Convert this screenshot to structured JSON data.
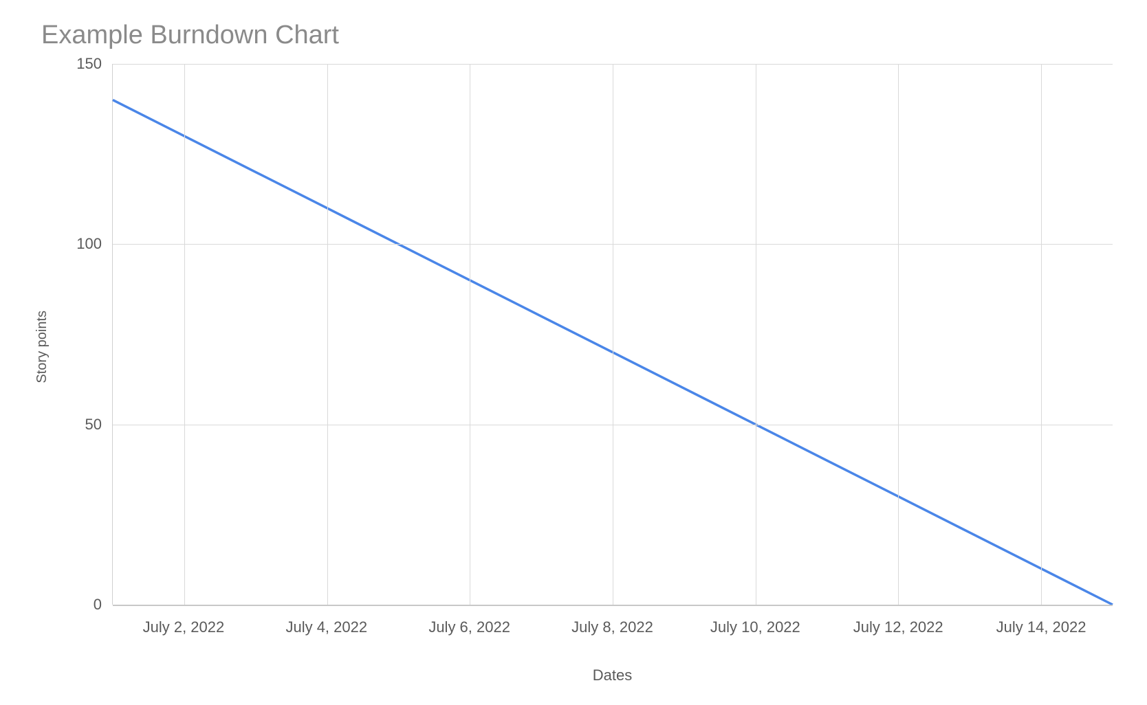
{
  "chart_data": {
    "type": "line",
    "title": "Example Burndown Chart",
    "xlabel": "Dates",
    "ylabel": "Story points",
    "ylim": [
      0,
      150
    ],
    "y_ticks": [
      0,
      50,
      100,
      150
    ],
    "x_tick_labels": [
      "July 2, 2022",
      "July 4, 2022",
      "July 6, 2022",
      "July 8, 2022",
      "July 10, 2022",
      "July 12, 2022",
      "July 14, 2022"
    ],
    "x_tick_positions": [
      1,
      3,
      5,
      7,
      9,
      11,
      13
    ],
    "x_domain": [
      0,
      14
    ],
    "x": [
      0,
      1,
      2,
      3,
      4,
      5,
      6,
      7,
      8,
      9,
      10,
      11,
      12,
      13,
      14
    ],
    "values": [
      140,
      130,
      120,
      110,
      100,
      90,
      80,
      70,
      60,
      50,
      40,
      30,
      20,
      10,
      0
    ],
    "line_color": "#4a86e8"
  }
}
